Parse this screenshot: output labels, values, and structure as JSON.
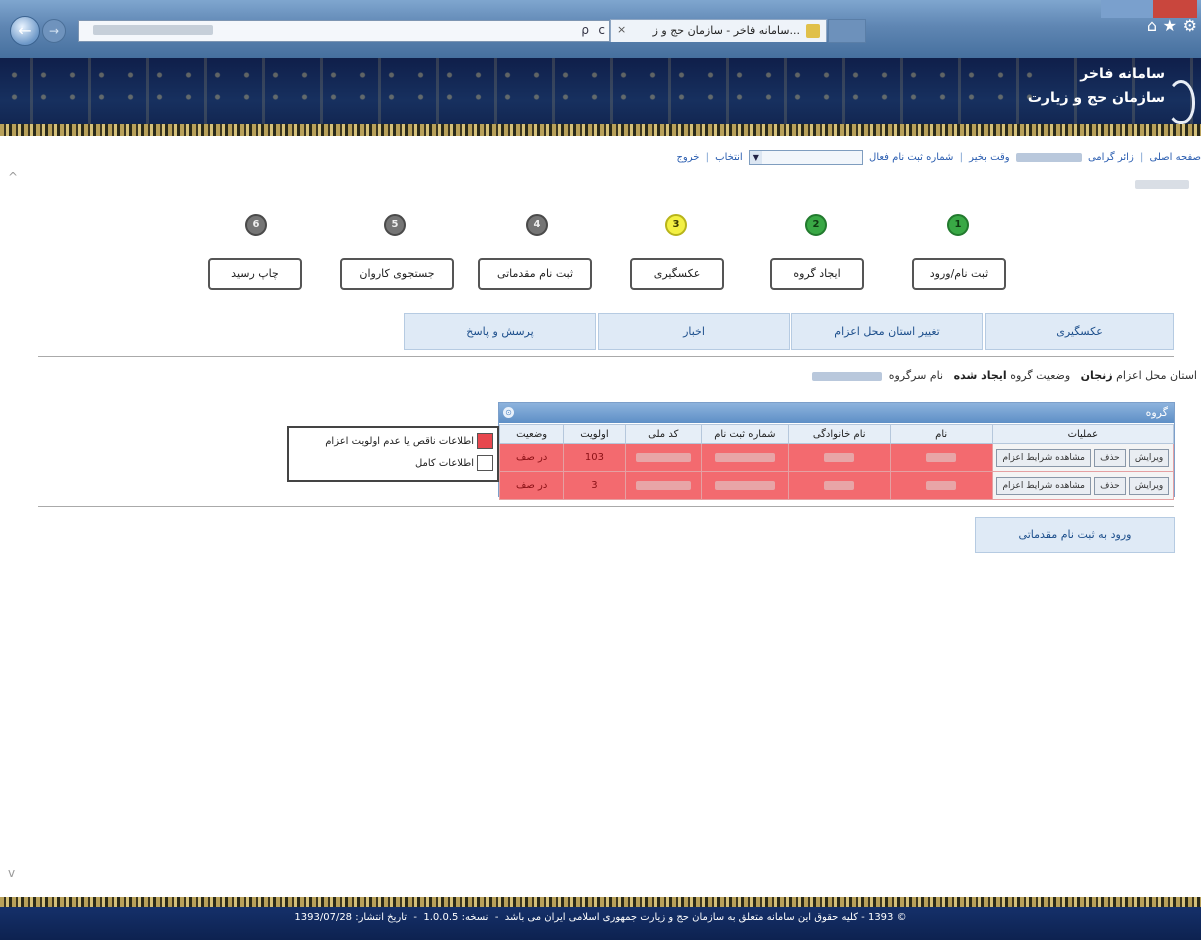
{
  "browser": {
    "tab_title": "...سامانه فاخر - سازمان حج و ز",
    "tab_close": "×",
    "search_icon": "ρ",
    "refresh_icon": "c",
    "home_icon": "⌂",
    "star_icon": "★",
    "gear_icon": "⚙"
  },
  "site": {
    "title_line1": "سامانه فاخر",
    "title_line2": "سازمان حج و زیارت"
  },
  "topbar": {
    "home_link": "صفحه اصلی",
    "greeting": "زائر گرامی",
    "welcome": "وقت بخیر",
    "reg_number_label": "شماره ثبت نام فعال",
    "select_label": "انتخاب",
    "logout_link": "خروج",
    "separator": "|"
  },
  "steps": [
    {
      "number": "1",
      "label": "ثبت نام/ورود",
      "state": "done"
    },
    {
      "number": "2",
      "label": "ایجاد گروه",
      "state": "done"
    },
    {
      "number": "3",
      "label": "عکسگیری",
      "state": "current"
    },
    {
      "number": "4",
      "label": "ثبت نام مقدماتی",
      "state": "pending"
    },
    {
      "number": "5",
      "label": "جستجوی کاروان",
      "state": "pending"
    },
    {
      "number": "6",
      "label": "چاپ رسید",
      "state": "pending"
    }
  ],
  "menu": [
    {
      "label": "عکسگیری"
    },
    {
      "label": "تغییر استان محل اعزام"
    },
    {
      "label": "اخبار"
    },
    {
      "label": "پرسش و پاسخ"
    }
  ],
  "info": {
    "province_label": "استان محل اعزام",
    "province_value": "زنجان",
    "group_status_label": "وضعیت گروه",
    "group_status_value": "ایجاد شده",
    "leader_label": "نام سرگروه"
  },
  "grid": {
    "title": "گروه",
    "collapse_icon": "⊙",
    "headers": [
      "عملیات",
      "نام",
      "نام خانوادگی",
      "شماره ثبت نام",
      "کد ملی",
      "اولویت",
      "وضعیت"
    ],
    "buttons": {
      "edit": "ویرایش",
      "delete": "حذف",
      "view": "مشاهده شرایط اعزام"
    },
    "rows": [
      {
        "priority": "103",
        "status": "در صف"
      },
      {
        "priority": "3",
        "status": "در صف"
      }
    ]
  },
  "legend": {
    "incomplete": "اطلاعات ناقص یا عدم اولویت اعزام",
    "complete": "اطلاعات کامل",
    "incomplete_color": "#e8474e",
    "complete_color": "#ffffff"
  },
  "actions": {
    "go_prereg": "ورود به ثبت نام مقدماتی"
  },
  "footer": {
    "copyright": "© 1393 - کلیه حقوق این سامانه متعلق به سازمان حج و زیارت جمهوری اسلامی ایران می باشد",
    "version_label": "نسخه:",
    "version": "1.0.0.5",
    "date_label": "تاریخ انتشار:",
    "date": "1393/07/28"
  },
  "colors": {
    "row_incomplete": "#f36a6f",
    "step_done": "#39a845",
    "step_current": "#f3f043",
    "step_pending": "#757575",
    "menu_bg": "#dfeaf6"
  }
}
